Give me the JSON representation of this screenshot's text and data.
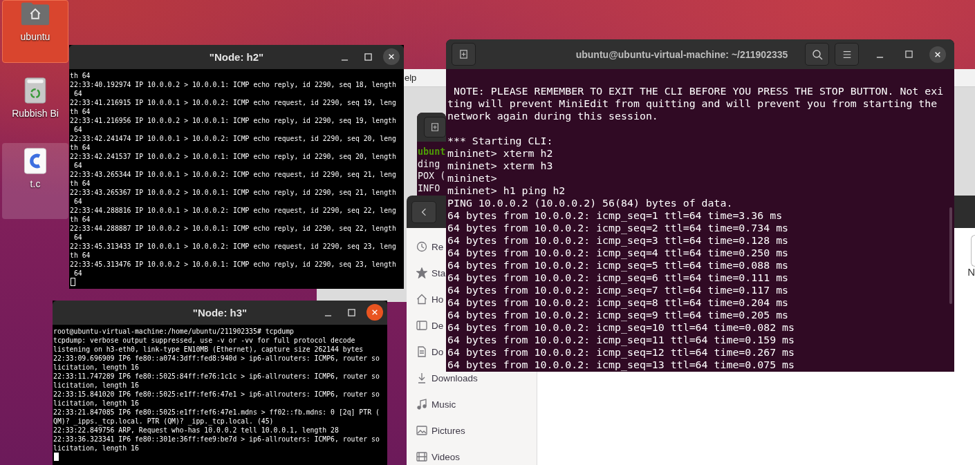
{
  "desktop": {
    "icons": [
      {
        "label": "ubuntu",
        "kind": "home",
        "selected": true,
        "hovered": false
      },
      {
        "label": "Rubbish Bi",
        "kind": "trash",
        "selected": false,
        "hovered": false
      },
      {
        "label": "t.c",
        "kind": "c_file",
        "selected": false,
        "hovered": true
      }
    ]
  },
  "miniedit": {
    "menu_fragment": "elp"
  },
  "background_terminal": {
    "prompt": "ubunt",
    "lines": [
      "ding",
      "POX (",
      "INFO"
    ]
  },
  "files": {
    "sidebar": [
      {
        "label": "Re",
        "kind": "recent"
      },
      {
        "label": "Sta",
        "kind": "starred"
      },
      {
        "label": "Ho",
        "kind": "home"
      },
      {
        "label": "De",
        "kind": "desktop"
      },
      {
        "label": "Do",
        "kind": "documents"
      },
      {
        "label": "Downloads",
        "kind": "downloads"
      },
      {
        "label": "Music",
        "kind": "music"
      },
      {
        "label": "Pictures",
        "kind": "pictures"
      },
      {
        "label": "Videos",
        "kind": "videos"
      }
    ],
    "item_fragment": "N"
  },
  "h2": {
    "title": "\"Node: h2\"",
    "focused": false,
    "lines": [
      "th 64",
      "22:33:40.192974 IP 10.0.0.2 > 10.0.0.1: ICMP echo reply, id 2290, seq 18, length",
      " 64",
      "22:33:41.216915 IP 10.0.0.1 > 10.0.0.2: ICMP echo request, id 2290, seq 19, leng",
      "th 64",
      "22:33:41.216956 IP 10.0.0.2 > 10.0.0.1: ICMP echo reply, id 2290, seq 19, length",
      " 64",
      "22:33:42.241474 IP 10.0.0.1 > 10.0.0.2: ICMP echo request, id 2290, seq 20, leng",
      "th 64",
      "22:33:42.241537 IP 10.0.0.2 > 10.0.0.1: ICMP echo reply, id 2290, seq 20, length",
      " 64",
      "22:33:43.265344 IP 10.0.0.1 > 10.0.0.2: ICMP echo request, id 2290, seq 21, leng",
      "th 64",
      "22:33:43.265367 IP 10.0.0.2 > 10.0.0.1: ICMP echo reply, id 2290, seq 21, length",
      " 64",
      "22:33:44.288816 IP 10.0.0.1 > 10.0.0.2: ICMP echo request, id 2290, seq 22, leng",
      "th 64",
      "22:33:44.288887 IP 10.0.0.2 > 10.0.0.1: ICMP echo reply, id 2290, seq 22, length",
      " 64",
      "22:33:45.313433 IP 10.0.0.1 > 10.0.0.2: ICMP echo request, id 2290, seq 23, leng",
      "th 64",
      "22:33:45.313476 IP 10.0.0.2 > 10.0.0.1: ICMP echo reply, id 2290, seq 23, length",
      " 64"
    ]
  },
  "h3": {
    "title": "\"Node: h3\"",
    "focused": true,
    "lines": [
      "root@ubuntu-virtual-machine:/home/ubuntu/211902335# tcpdump",
      "tcpdump: verbose output suppressed, use -v or -vv for full protocol decode",
      "listening on h3-eth0, link-type EN10MB (Ethernet), capture size 262144 bytes",
      "22:33:09.696909 IP6 fe80::a074:3dff:fed8:940d > ip6-allrouters: ICMP6, router so",
      "licitation, length 16",
      "22:33:11.747289 IP6 fe80::5025:84ff:fe76:1c1c > ip6-allrouters: ICMP6, router so",
      "licitation, length 16",
      "22:33:15.841020 IP6 fe80::5025:e1ff:fef6:47e1 > ip6-allrouters: ICMP6, router so",
      "licitation, length 16",
      "22:33:21.847085 IP6 fe80::5025:e1ff:fef6:47e1.mdns > ff02::fb.mdns: 0 [2q] PTR (",
      "QM)? _ipps._tcp.local. PTR (QM)? _ipp._tcp.local. (45)",
      "22:33:22.849756 ARP, Request who-has 10.0.0.2 tell 10.0.0.1, length 28",
      "22:33:36.323341 IP6 fe80::301e:36ff:fee9:be7d > ip6-allrouters: ICMP6, router so",
      "licitation, length 16"
    ]
  },
  "main_terminal": {
    "title": "ubuntu@ubuntu-virtual-machine: ~/211902335",
    "focused": false,
    "blocks": [
      [
        " NOTE: PLEASE REMEMBER TO EXIT THE CLI BEFORE YOU PRESS THE STOP BUTTON. Not exi",
        "ting will prevent MiniEdit from quitting and will prevent you from starting the",
        "network again during this session."
      ],
      [
        "*** Starting CLI:",
        "mininet> xterm h2",
        "mininet> xterm h3",
        "mininet>",
        "mininet> h1 ping h2",
        "PING 10.0.0.2 (10.0.0.2) 56(84) bytes of data.",
        "64 bytes from 10.0.0.2: icmp_seq=1 ttl=64 time=3.36 ms",
        "64 bytes from 10.0.0.2: icmp_seq=2 ttl=64 time=0.734 ms",
        "64 bytes from 10.0.0.2: icmp_seq=3 ttl=64 time=0.128 ms",
        "64 bytes from 10.0.0.2: icmp_seq=4 ttl=64 time=0.250 ms",
        "64 bytes from 10.0.0.2: icmp_seq=5 ttl=64 time=0.088 ms",
        "64 bytes from 10.0.0.2: icmp_seq=6 ttl=64 time=0.111 ms",
        "64 bytes from 10.0.0.2: icmp_seq=7 ttl=64 time=0.117 ms",
        "64 bytes from 10.0.0.2: icmp_seq=8 ttl=64 time=0.204 ms",
        "64 bytes from 10.0.0.2: icmp_seq=9 ttl=64 time=0.205 ms",
        "64 bytes from 10.0.0.2: icmp_seq=10 ttl=64 time=0.082 ms",
        "64 bytes from 10.0.0.2: icmp_seq=11 ttl=64 time=0.159 ms",
        "64 bytes from 10.0.0.2: icmp_seq=12 ttl=64 time=0.267 ms",
        "64 bytes from 10.0.0.2: icmp_seq=13 ttl=64 time=0.075 ms"
      ]
    ]
  }
}
